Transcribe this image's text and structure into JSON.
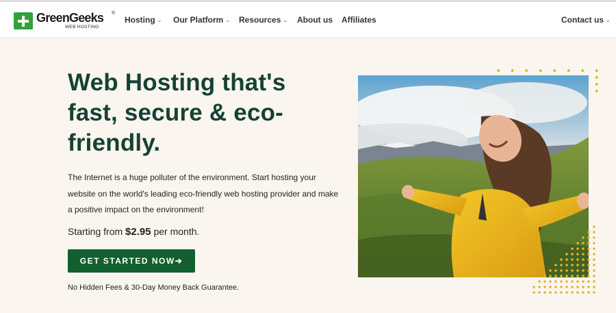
{
  "header": {
    "logo": {
      "name": "GreenGeeks",
      "registered": "®",
      "subtitle": "WEB HOSTING"
    },
    "nav": [
      {
        "label": "Hosting",
        "has_dropdown": true
      },
      {
        "label": "Our Platform",
        "has_dropdown": true
      },
      {
        "label": "Resources",
        "has_dropdown": true
      },
      {
        "label": "About us",
        "has_dropdown": false
      },
      {
        "label": "Affiliates",
        "has_dropdown": false
      }
    ],
    "contact": {
      "label": "Contact us",
      "has_dropdown": true
    }
  },
  "hero": {
    "headline": "Web Hosting that's fast, secure & eco-friendly.",
    "description": "The Internet is a huge polluter of the environment. Start hosting your website on the world's leading eco-friendly web hosting provider and make a positive impact on the environment!",
    "price_prefix": "Starting from ",
    "price": "$2.95",
    "price_suffix": " per month.",
    "cta_label": "GET STARTED NOW",
    "cta_arrow": "➔",
    "guarantee": "No Hidden Fees & 30-Day Money Back Guarantee."
  },
  "colors": {
    "brand_green": "#2fa33a",
    "headline_green": "#164234",
    "cta_green": "#135f2f",
    "page_background": "#faf6ef",
    "dot_accent": "#e7b32e"
  },
  "icons": {
    "dropdown": "chevron-down-icon",
    "logo_mark": "plus-icon",
    "cta": "arrow-right-icon"
  }
}
